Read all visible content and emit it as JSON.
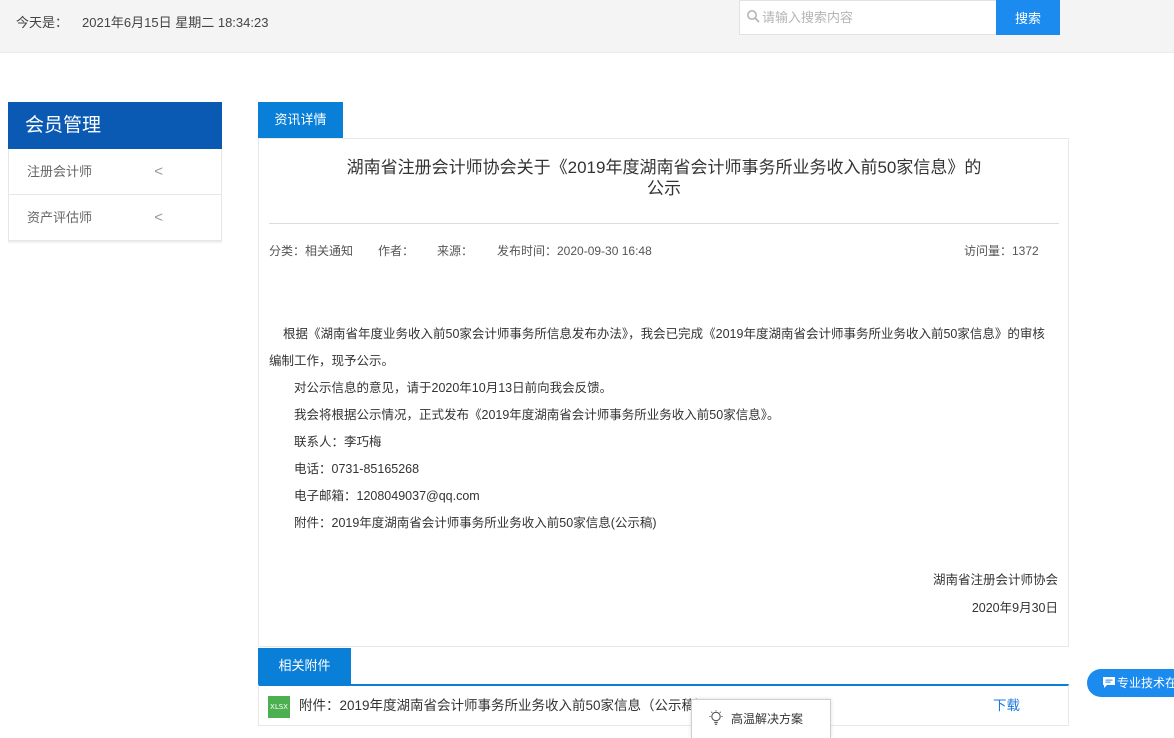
{
  "header": {
    "date_label": "今天是：",
    "date_value": "2021年6月15日 星期二 18:34:23",
    "search_placeholder": "请输入搜索内容",
    "search_button": "搜索"
  },
  "sidebar": {
    "title": "会员管理",
    "items": [
      {
        "label": "注册会计师"
      },
      {
        "label": "资产评估师"
      }
    ]
  },
  "main": {
    "detail_tab": "资讯详情",
    "title_line1": "湖南省注册会计师协会关于《2019年度湖南省会计师事务所业务收入前50家信息》的",
    "title_line2": "公示",
    "meta": {
      "category": "分类：相关通知",
      "author": "作者：",
      "source": "来源：",
      "publish_time": "发布时间：2020-09-30 16:48",
      "visits": "访问量：1372"
    },
    "body": {
      "p1_line1": "根据《湖南省年度业务收入前50家会计师事务所信息发布办法》，我会已完成《2019年度湖南省会计师事务所业务收入前50家信息》的审核",
      "p1_line2": "编制工作，现予公示。",
      "p2": "对公示信息的意见，请于2020年10月13日前向我会反馈。",
      "p3": "我会将根据公示情况，正式发布《2019年度湖南省会计师事务所业务收入前50家信息》。",
      "contact": "联系人：李巧梅",
      "phone": "电话：0731-85165268",
      "email": "电子邮箱：1208049037@qq.com",
      "attachment": "附件：2019年度湖南省会计师事务所业务收入前50家信息(公示稿)"
    },
    "signature_org": "湖南省注册会计师协会",
    "signature_date": "2020年9月30日"
  },
  "attachments": {
    "tab": "相关附件",
    "file_badge": "XLSX",
    "file_name": "附件：2019年度湖南省会计师事务所业务收入前50家信息（公示稿）2020-9-30.xlsx",
    "download": "下载"
  },
  "popup": {
    "label": "高温解决方案"
  },
  "support": {
    "label": "专业技术在线"
  }
}
